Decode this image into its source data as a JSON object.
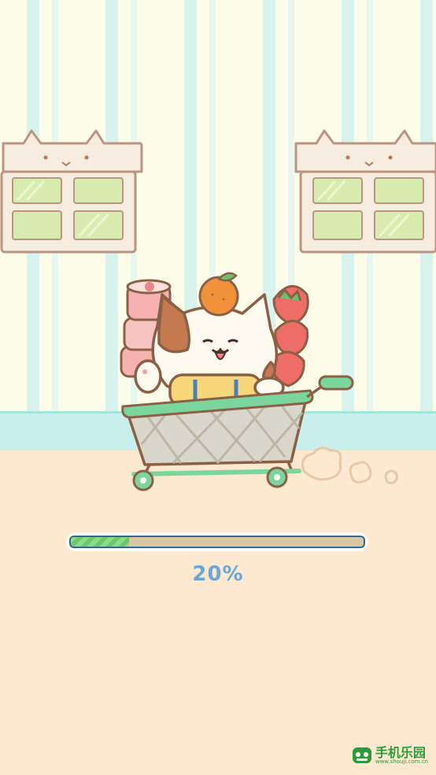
{
  "loading": {
    "progress_percent": 20,
    "progress_label": "20%"
  },
  "watermark": {
    "main_text": "手机乐园",
    "sub_text": "www.shouji.com.cn"
  },
  "colors": {
    "wall": "#fefde9",
    "wall_stripe": "#d8f3ee",
    "wall_trim": "#c8efeb",
    "floor": "#fde9cf",
    "progress_fill": "#7fd37a",
    "progress_track": "#d8c6a5",
    "progress_border": "#2f6a8f",
    "label": "#6aa7d8",
    "cart_rim": "#7bd69e"
  }
}
